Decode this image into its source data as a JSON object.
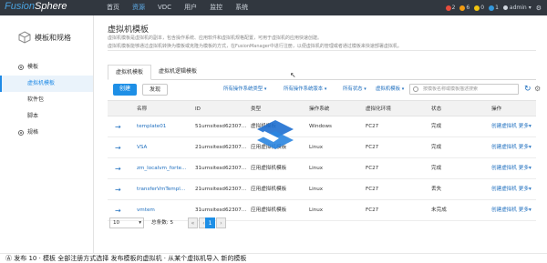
{
  "app": {
    "logo_part1": "Fusion",
    "logo_part2": "Sphere"
  },
  "nav": {
    "items": [
      "首页",
      "资源",
      "VDC",
      "用户",
      "监控",
      "系统"
    ],
    "active_index": 1
  },
  "alarms": [
    {
      "count": "2",
      "color": "#e74c3c"
    },
    {
      "count": "6",
      "color": "#f39c12"
    },
    {
      "count": "0",
      "color": "#f1c40f"
    },
    {
      "count": "1",
      "color": "#3498db"
    }
  ],
  "user": {
    "name": "admin",
    "caret": "▾",
    "gear": "⚙"
  },
  "sidebar": {
    "title": "模板和规格",
    "section_template": "模板",
    "items": [
      "虚拟机模板",
      "软件包",
      "脚本"
    ],
    "active_index": 0,
    "section_spec": "规格"
  },
  "main": {
    "title": "虚拟机模板",
    "desc1": "虚拟机模板是虚拟机的副本，包含操作系统、应用软件和虚拟机规格配置，可用于虚拟机的应用快速创建。",
    "desc2": "虚拟机模板能够通过虚拟机转换为模板或克隆为模板的方式，在FusionManager中进行注册，以便虚拟机的管理或者通过模板来快速部署虚拟机。",
    "tabs": [
      "虚拟机模板",
      "虚拟机逻辑模板"
    ],
    "active_tab": 0
  },
  "toolbar": {
    "create": "创建",
    "discover": "发现",
    "filters": [
      "所有操作系统类型",
      "所有操作系统版本",
      "所有状态",
      "虚拟机模板"
    ],
    "search_placeholder": "按模板名称或模板描述搜索",
    "refresh": "↻",
    "settings": "⚙"
  },
  "table": {
    "headers": [
      "",
      "名称",
      "ID",
      "类型",
      "操作系统",
      "虚拟化环境",
      "状态",
      "操作"
    ],
    "rows": [
      {
        "name": "template01",
        "id": "51urnsitesd62307...",
        "type": "虚拟机模板",
        "os": "Windows",
        "env": "FC27",
        "status": "完成",
        "action": "创建虚拟机",
        "more": "更多"
      },
      {
        "name": "VSA",
        "id": "21urnsitesd62307...",
        "type": "应用虚拟机模板",
        "os": "Linux",
        "env": "FC27",
        "status": "完成",
        "action": "创建虚拟机",
        "more": "更多"
      },
      {
        "name": "zm_localvm_forte...",
        "id": "31urnsitesd62307...",
        "type": "应用虚拟机模板",
        "os": "Linux",
        "env": "FC27",
        "status": "完成",
        "action": "创建虚拟机",
        "more": "更多"
      },
      {
        "name": "transferVmTempl...",
        "id": "21urnsitesd62307...",
        "type": "应用虚拟机模板",
        "os": "Linux",
        "env": "FC27",
        "status": "丢失",
        "action": "创建虚拟机",
        "more": "更多"
      },
      {
        "name": "vmtem",
        "id": "31urnsitesd62307...",
        "type": "应用虚拟机模板",
        "os": "Linux",
        "env": "FC27",
        "status": "未完成",
        "action": "创建虚拟机",
        "more": "更多"
      }
    ],
    "row_arrow": "→",
    "more_caret": "▾"
  },
  "pager": {
    "page_size": "10",
    "total_label": "总条数: 5",
    "current": "1",
    "prev": "‹",
    "first": "«",
    "next": "›",
    "last": "»"
  },
  "bottom_text": "Ⓐ 发布  10  ·  模板  全部注册方式选择   发布模板的虚拟机  ·  从某个虚拟机导入  新的模板"
}
